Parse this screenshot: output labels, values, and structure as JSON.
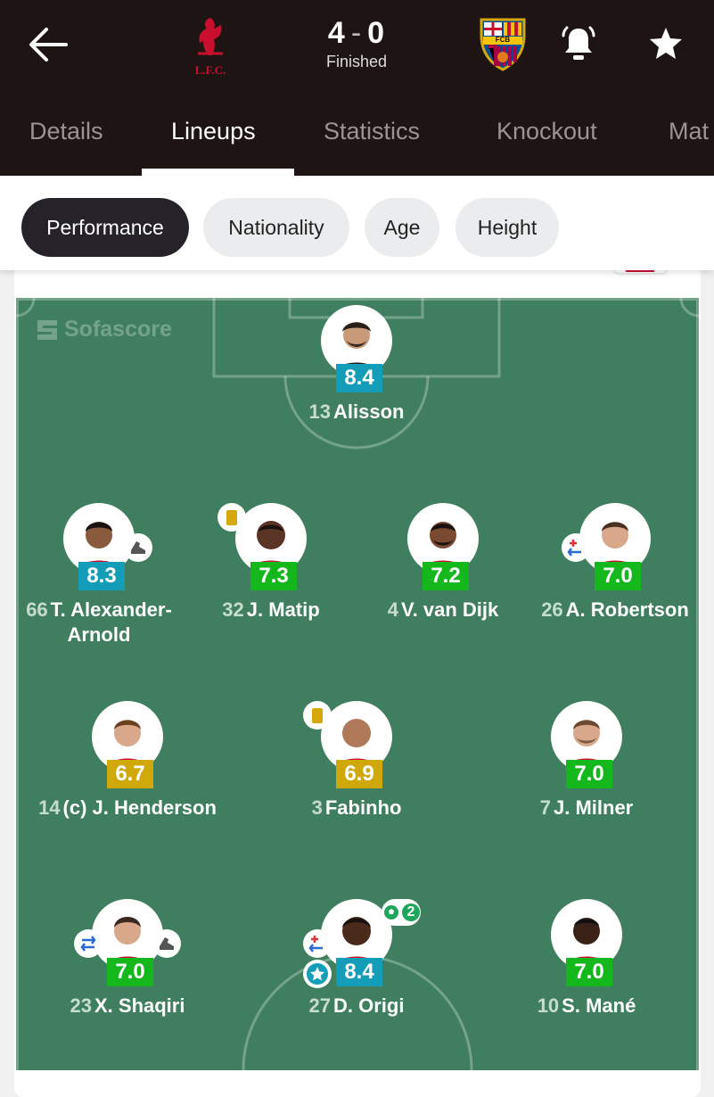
{
  "header": {
    "home_team": "L.F.C.",
    "away_team_abbr": "FCB",
    "score_home": "4",
    "score_away": "0",
    "score_separator": "-",
    "status": "Finished"
  },
  "tabs": [
    {
      "label": "Details"
    },
    {
      "label": "Lineups"
    },
    {
      "label": "Statistics"
    },
    {
      "label": "Knockout"
    },
    {
      "label": "Mat"
    }
  ],
  "filters": [
    {
      "label": "Performance"
    },
    {
      "label": "Nationality"
    },
    {
      "label": "Age"
    },
    {
      "label": "Height"
    }
  ],
  "watermark": "Sofascore",
  "colors": {
    "rating_blue": "#139db8",
    "rating_green": "#14b81c",
    "rating_yellow": "#d0a80a",
    "pitch": "#3f7f5f",
    "header_bg": "#1e1414"
  },
  "players": [
    {
      "number": "13",
      "name": "Alisson",
      "rating": "8.4"
    },
    {
      "number": "66",
      "name": "T. Alexander-",
      "name2": "Arnold",
      "rating": "8.3"
    },
    {
      "number": "32",
      "name": "J. Matip",
      "rating": "7.3"
    },
    {
      "number": "4",
      "name": "V. van Dijk",
      "rating": "7.2"
    },
    {
      "number": "26",
      "name": "A. Robertson",
      "rating": "7.0"
    },
    {
      "number": "14",
      "name": "(c) J. Henderson",
      "rating": "6.7"
    },
    {
      "number": "3",
      "name": "Fabinho",
      "rating": "6.9"
    },
    {
      "number": "7",
      "name": "J. Milner",
      "rating": "7.0"
    },
    {
      "number": "23",
      "name": "X. Shaqiri",
      "rating": "7.0"
    },
    {
      "number": "27",
      "name": "D. Origi",
      "rating": "8.4",
      "goals": "2"
    },
    {
      "number": "10",
      "name": "S. Mané",
      "rating": "7.0"
    }
  ]
}
